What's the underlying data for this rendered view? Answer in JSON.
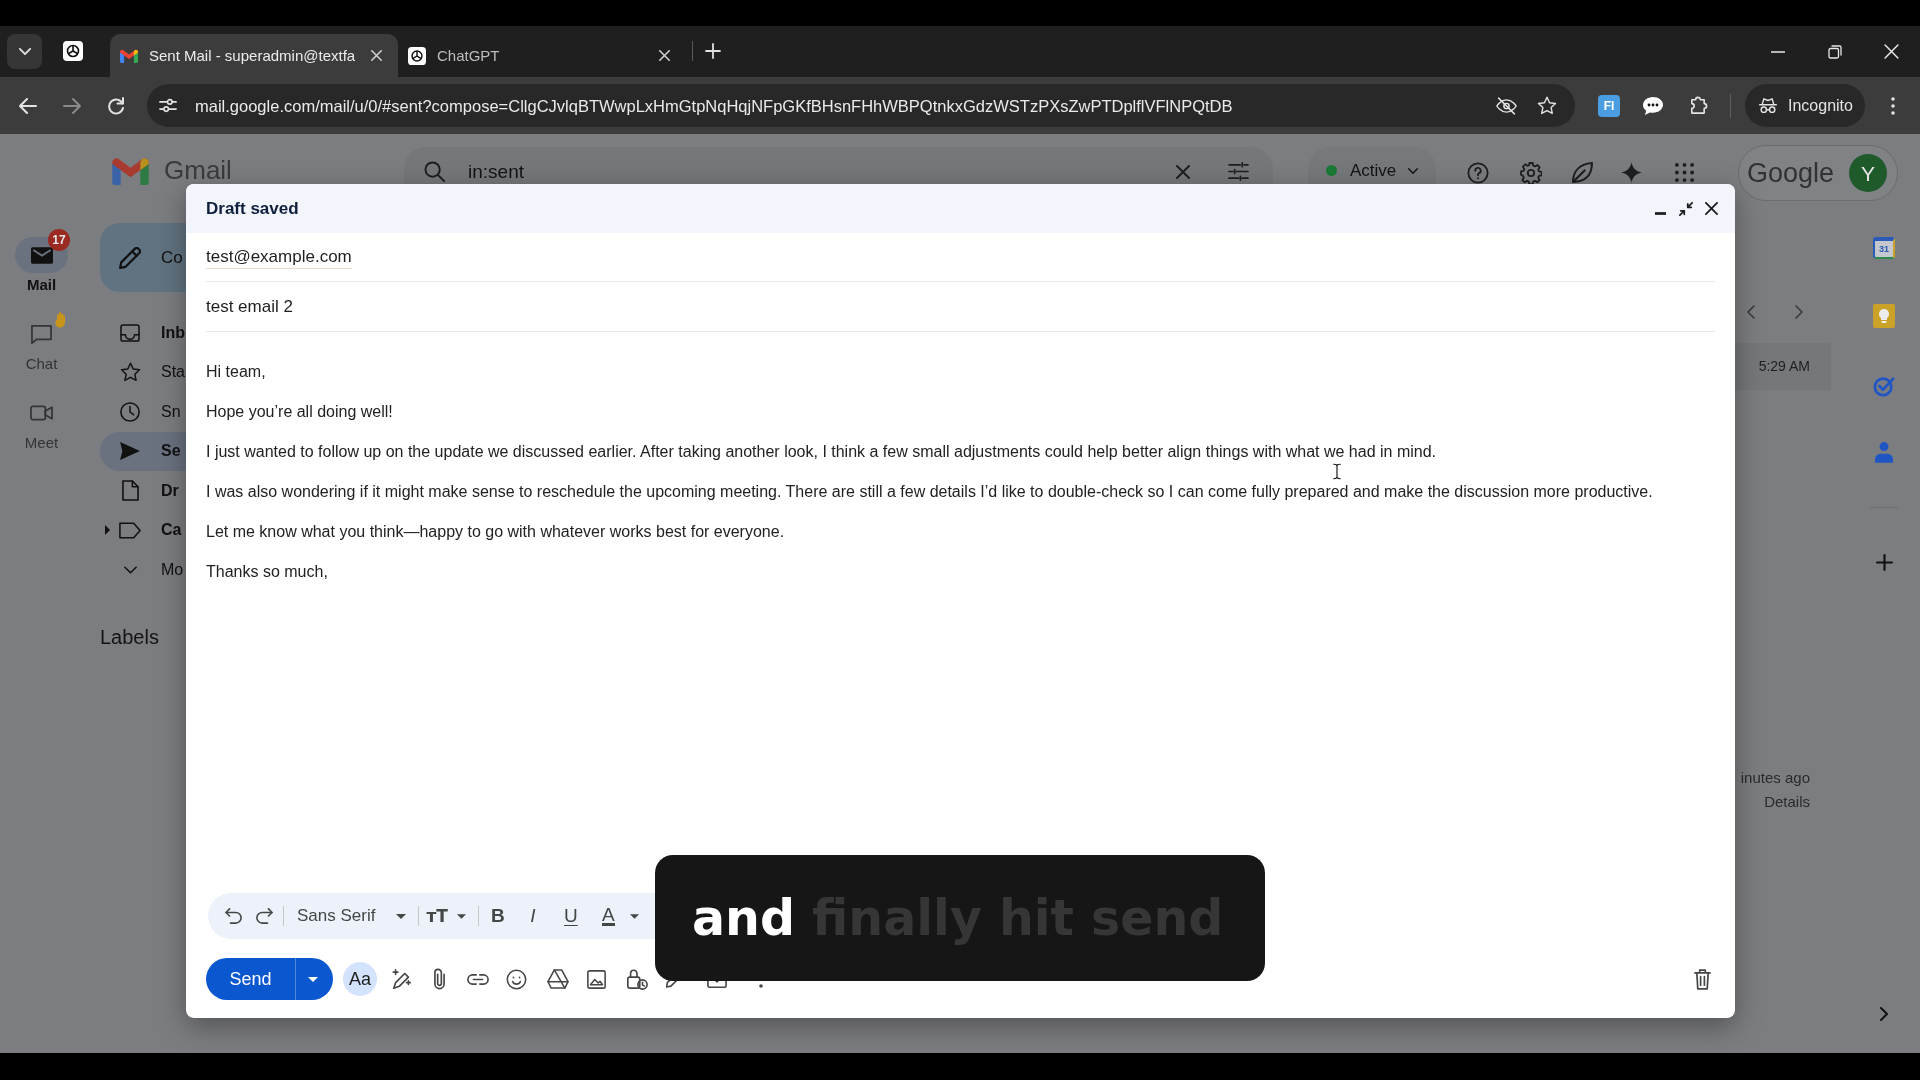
{
  "browser": {
    "tabs": [
      {
        "kind": "mail",
        "title": "Sent Mail - superadmin@textfa",
        "selected": true
      },
      {
        "kind": "chat",
        "title": "ChatGPT",
        "selected": false
      }
    ],
    "url": "mail.google.com/mail/u/0/#sent?compose=CllgCJvlqBTWwpLxHmGtpNqHqjNFpGKfBHsnFHhWBPQtnkxGdzWSTzPXsZwPTDplflVFlNPQtDB",
    "extension": "FI",
    "profile": "Incognito"
  },
  "gmail": {
    "logo": "Gmail",
    "search": {
      "value": "in:sent"
    },
    "status": "Active",
    "account": {
      "logo": "Google",
      "avatar": "Y"
    },
    "rail": [
      {
        "kind": "mail",
        "label": "Mail",
        "badge": "17",
        "selected": true
      },
      {
        "kind": "chat",
        "label": "Chat",
        "selected": false
      },
      {
        "kind": "meet",
        "label": "Meet",
        "selected": false
      }
    ],
    "compose_button": "Co",
    "nav": [
      {
        "kind": "inbox",
        "label": "Inb",
        "unread": true,
        "selected": false
      },
      {
        "kind": "starred",
        "label": "Sta",
        "unread": false,
        "selected": false
      },
      {
        "kind": "snoozed",
        "label": "Sn",
        "unread": false,
        "selected": false
      },
      {
        "kind": "sent",
        "label": "Se",
        "unread": false,
        "selected": true
      },
      {
        "kind": "drafts",
        "label": "Dr",
        "unread": true,
        "selected": false
      },
      {
        "kind": "categories",
        "label": "Ca",
        "unread": true,
        "selected": false
      },
      {
        "kind": "more",
        "label": "Mo",
        "unread": false,
        "selected": false
      }
    ],
    "labels_heading": "Labels",
    "list": {
      "time": "5:29 AM"
    },
    "thread": {
      "age": "inutes ago",
      "details": "Details"
    },
    "side_panel": {
      "calendar_day": "31"
    }
  },
  "compose": {
    "title": "Draft saved",
    "to": "test@example.com",
    "subject": "test email 2",
    "body": [
      "Hi team,",
      "Hope you’re all doing well!",
      "I just wanted to follow up on the update we discussed earlier. After taking another look, I think a few small adjustments could help better align things with what we had in mind.",
      "I was also wondering if it might make sense to reschedule the upcoming meeting. There are still a few details I’d like to double-check so I can come fully prepared and make the discussion more productive.",
      "Let me know what you think—happy to go with whatever works best for everyone.",
      "Thanks so much,"
    ],
    "font": "Sans Serif",
    "text_size": "ᴛT",
    "format_buttons": [
      {
        "kind": "bold",
        "label": "B"
      },
      {
        "kind": "italic",
        "label": "I"
      },
      {
        "kind": "underline",
        "label": "U"
      },
      {
        "kind": "color",
        "label": "A"
      }
    ],
    "send": "Send",
    "formatting_toggle": "Aa"
  },
  "caption": {
    "words": [
      {
        "text": "and",
        "highlighted": true
      },
      {
        "text": "finally hit send",
        "highlighted": false
      }
    ]
  }
}
